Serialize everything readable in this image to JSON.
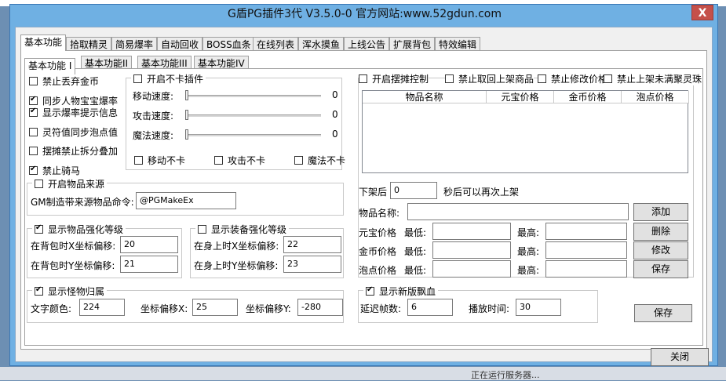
{
  "window": {
    "title": "G盾PG插件3代 V3.5.0-0  官方网站:www.52gdun.com",
    "close_glyph": "X"
  },
  "background": {
    "taskbar_text": "正在运行服务器..."
  },
  "main_tabs": [
    "基本功能",
    "拾取精灵",
    "简易爆率",
    "自动回收",
    "BOSS血条",
    "在线列表",
    "浑水摸鱼",
    "上线公告",
    "扩展背包",
    "特效编辑"
  ],
  "sub_tabs": [
    "基本功能 I",
    "基本功能II",
    "基本功能III",
    "基本功能IV"
  ],
  "left_options": [
    {
      "label": "禁止丢弃金币",
      "checked": false
    },
    {
      "label": "同步人物宝宝爆率",
      "checked": true
    },
    {
      "label": "显示爆率提示信息",
      "checked": true
    },
    {
      "label": "灵符值同步泡点值",
      "checked": false
    },
    {
      "label": "摆摊禁止拆分叠加",
      "checked": false
    },
    {
      "label": "禁止骑马",
      "checked": true
    }
  ],
  "no_lag": {
    "title": "开启不卡插件",
    "checked": false,
    "sliders": [
      {
        "label": "移动速度:",
        "value": "0"
      },
      {
        "label": "攻击速度:",
        "value": "0"
      },
      {
        "label": "魔法速度:",
        "value": "0"
      }
    ],
    "checks": [
      {
        "label": "移动不卡",
        "checked": false
      },
      {
        "label": "攻击不卡",
        "checked": false
      },
      {
        "label": "魔法不卡",
        "checked": false
      }
    ]
  },
  "item_source": {
    "title": "开启物品来源",
    "checked": false,
    "cmd_label": "GM制造带来源物品命令:",
    "cmd_value": "@PGMakeEx"
  },
  "item_enhance": {
    "title": "显示物品强化等级",
    "checked": true,
    "x_label": "在背包时X坐标偏移:",
    "x_value": "20",
    "y_label": "在背包时Y坐标偏移:",
    "y_value": "21"
  },
  "equip_enhance": {
    "title": "显示装备强化等级",
    "checked": false,
    "x_label": "在身上时X坐标偏移:",
    "x_value": "22",
    "y_label": "在身上时Y坐标偏移:",
    "y_value": "23"
  },
  "monster_owner": {
    "title": "显示怪物归属",
    "checked": true,
    "color_label": "文字颜色:",
    "color_value": "224",
    "offx_label": "坐标偏移X:",
    "offx_value": "25",
    "offy_label": "坐标偏移Y:",
    "offy_value": "-280"
  },
  "stall": {
    "checks": [
      {
        "label": "开启摆摊控制",
        "checked": false
      },
      {
        "label": "禁止取回上架商品",
        "checked": false
      },
      {
        "label": "禁止修改价格",
        "checked": false
      },
      {
        "label": "禁止上架未满聚灵珠",
        "checked": false
      }
    ],
    "columns": [
      "物品名称",
      "元宝价格",
      "金币价格",
      "泡点价格"
    ],
    "relist_prefix": "下架后",
    "relist_value": "0",
    "relist_suffix": "秒后可以再次上架",
    "item_name_label": "物品名称:",
    "price_rows": [
      {
        "label": "元宝价格",
        "min": "最低:",
        "max": "最高:"
      },
      {
        "label": "金币价格",
        "min": "最低:",
        "max": "最高:"
      },
      {
        "label": "泡点价格",
        "min": "最低:",
        "max": "最高:"
      }
    ],
    "buttons": {
      "add": "添加",
      "delete": "删除",
      "modify": "修改",
      "save": "保存"
    }
  },
  "blood": {
    "title": "显示新版飘血",
    "checked": true,
    "delay_label": "延迟帧数:",
    "delay_value": "6",
    "play_label": "播放时间:",
    "play_value": "30"
  },
  "save_button": "保存",
  "close_button": "关闭"
}
